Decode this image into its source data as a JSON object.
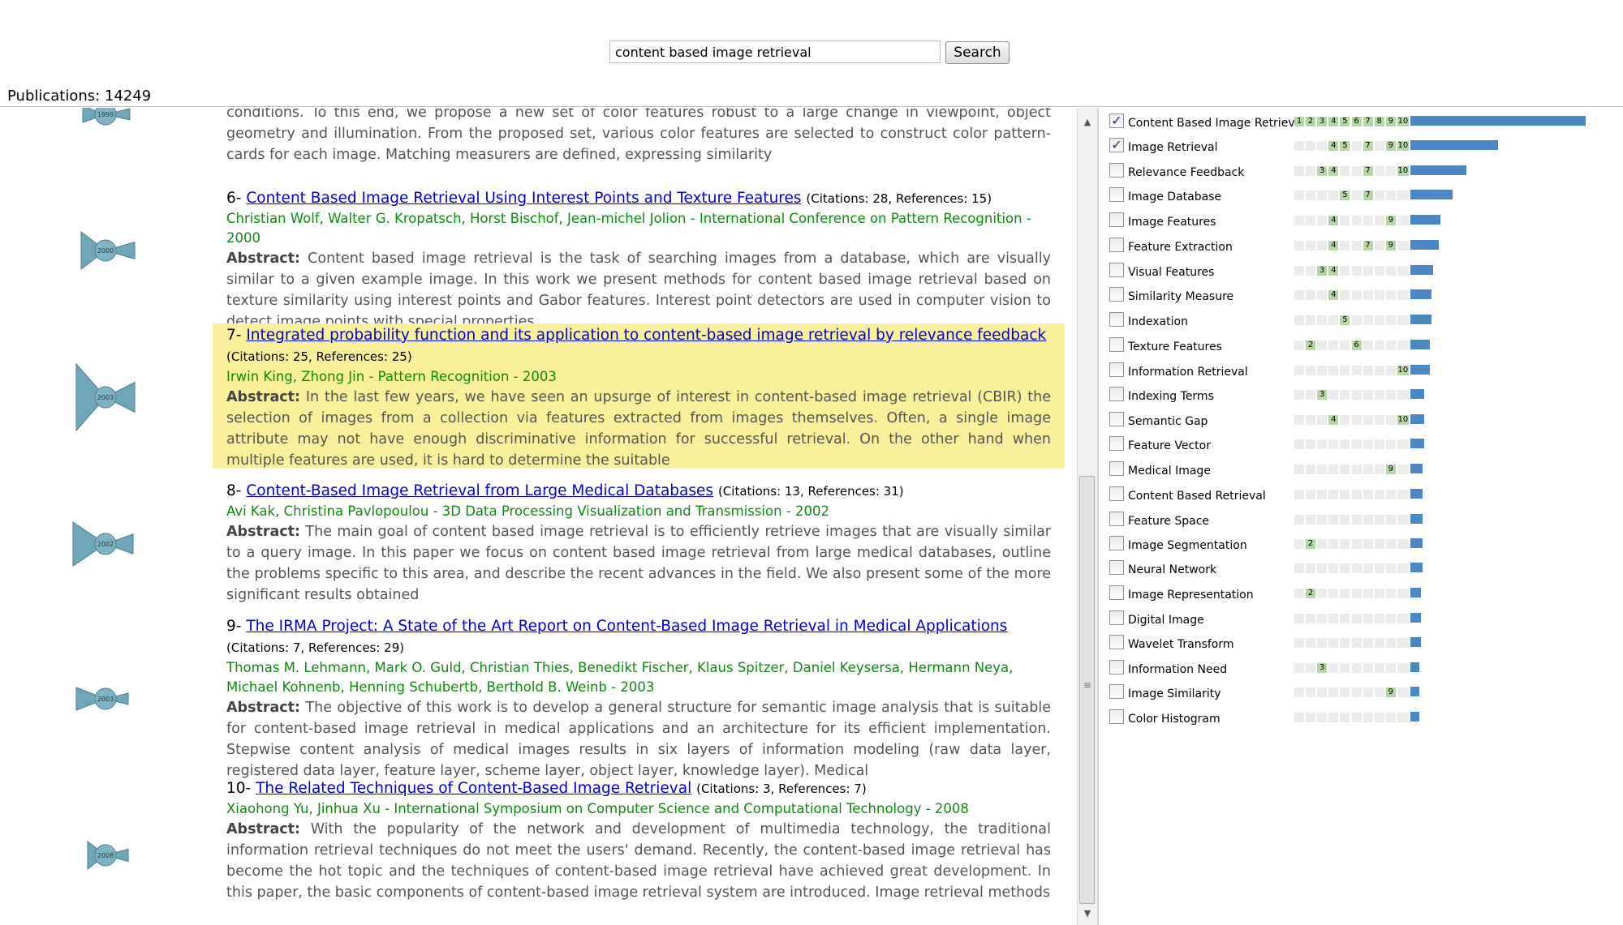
{
  "search": {
    "value": "content based image retrieval",
    "button_label": "Search"
  },
  "publications_count": "Publications: 14249",
  "colors": {
    "link": "#0000dd",
    "authors": "#118811",
    "highlight": "#f8f09a",
    "bar": "#4c86c3",
    "glyph": "#6fa6b8"
  },
  "abstract_label": "Abstract:",
  "glyph_years": [
    "1999",
    "2000",
    "2003",
    "2002",
    "2003",
    "2008"
  ],
  "publications": [
    {
      "number": "",
      "title": "",
      "citations": "",
      "authors": "",
      "abstract": "conditions. To this end, we propose a new set of color features robust to a large change in viewpoint, object geometry and illumination. From the proposed set, various color features are selected to construct color pattern-cards for each image. Matching measurers are defined, expressing similarity"
    },
    {
      "number": "6-",
      "title": "Content Based Image Retrieval Using Interest Points and Texture Features",
      "citations": "(Citations: 28, References: 15)",
      "authors": "Christian Wolf, Walter G. Kropatsch, Horst Bischof, Jean-michel Jolion - International Conference on Pattern Recognition - 2000",
      "abstract": "Content based image retrieval is the task of searching images from a database, which are visually similar to a given example image. In this work we present methods for content based image retrieval based on texture similarity using interest points and Gabor features. Interest point detectors are used in computer vision to detect image points with special properties,"
    },
    {
      "number": "7-",
      "title": "Integrated probability function and its application to content-based image retrieval by relevance feedback",
      "citations": "(Citations: 25, References: 25)",
      "authors": "Irwin King, Zhong Jin - Pattern Recognition - 2003",
      "abstract": "In the last few years, we have seen an upsurge of interest in content-based image retrieval (CBIR) the selection of images from a collection via features extracted from images themselves. Often, a single image attribute may not have enough discriminative information for successful retrieval. On the other hand when multiple features are used, it is hard to determine the suitable"
    },
    {
      "number": "8-",
      "title": "Content-Based Image Retrieval from Large Medical Databases",
      "citations": "(Citations: 13, References: 31)",
      "authors": "Avi Kak, Christina Pavlopoulou - 3D Data Processing Visualization and Transmission - 2002",
      "abstract": "The main goal of content based image retrieval is to efficiently retrieve images that are visually similar to a query image. In this paper we focus on content based image retrieval from large medical databases, outline the problems specific to this area, and describe the recent advances in the field. We also present some of the more significant results obtained"
    },
    {
      "number": "9-",
      "title": "The IRMA Project: A State of the Art Report on Content-Based Image Retrieval in Medical Applications",
      "citations": "(Citations: 7, References: 29)",
      "authors": "Thomas M. Lehmann, Mark O. Guld, Christian Thies, Benedikt Fischer, Klaus Spitzer, Daniel Keysersa, Hermann Neya, Michael Kohnenb, Henning Schubertb, Berthold B. Weinb - 2003",
      "abstract": "The objective of this work is to develop a general structure for semantic image analysis that is suitable for content-based image retrieval in medical applications and an architecture for its efficient implementation. Stepwise content analysis of medical images results in six layers of information modeling (raw data layer, registered data layer, feature layer, scheme layer, object layer, knowledge layer). Medical"
    },
    {
      "number": "10-",
      "title": "The Related Techniques of Content-Based Image Retrieval",
      "citations": "(Citations: 3, References: 7)",
      "authors": "Xiaohong Yu, Jinhua Xu - International Symposium on Computer Science and Computational Technology - 2008",
      "abstract": "With the popularity of the network and development of multimedia technology, the traditional information retrieval techniques do not meet the users' demand. Recently, the content-based image retrieval has become the hot topic and the techniques of content-based image retrieval have achieved great development. In this paper, the basic components of content-based image retrieval system are introduced. Image retrieval methods"
    }
  ],
  "keywords": [
    {
      "label": "Content Based Image Retrieval",
      "checked": true,
      "active": [
        1,
        2,
        3,
        4,
        5,
        6,
        7,
        8,
        9,
        10
      ],
      "weight": 1.0
    },
    {
      "label": "Image Retrieval",
      "checked": true,
      "active": [
        4,
        5,
        7,
        9,
        10
      ],
      "weight": 0.5
    },
    {
      "label": "Relevance Feedback",
      "checked": false,
      "active": [
        3,
        4,
        7,
        10
      ],
      "weight": 0.32
    },
    {
      "label": "Image Database",
      "checked": false,
      "active": [
        5,
        7
      ],
      "weight": 0.24
    },
    {
      "label": "Image Features",
      "checked": false,
      "active": [
        4,
        9
      ],
      "weight": 0.17
    },
    {
      "label": "Feature Extraction",
      "checked": false,
      "active": [
        4,
        7,
        9
      ],
      "weight": 0.16
    },
    {
      "label": "Visual Features",
      "checked": false,
      "active": [
        3,
        4
      ],
      "weight": 0.13
    },
    {
      "label": "Similarity Measure",
      "checked": false,
      "active": [
        4
      ],
      "weight": 0.12
    },
    {
      "label": "Indexation",
      "checked": false,
      "active": [
        5
      ],
      "weight": 0.12
    },
    {
      "label": "Texture Features",
      "checked": false,
      "active": [
        2,
        6
      ],
      "weight": 0.11
    },
    {
      "label": "Information Retrieval",
      "checked": false,
      "active": [
        10
      ],
      "weight": 0.11
    },
    {
      "label": "Indexing Terms",
      "checked": false,
      "active": [
        3
      ],
      "weight": 0.08
    },
    {
      "label": "Semantic Gap",
      "checked": false,
      "active": [
        4,
        10
      ],
      "weight": 0.08
    },
    {
      "label": "Feature Vector",
      "checked": false,
      "active": [],
      "weight": 0.08
    },
    {
      "label": "Medical Image",
      "checked": false,
      "active": [
        9
      ],
      "weight": 0.07
    },
    {
      "label": "Content Based Retrieval",
      "checked": false,
      "active": [],
      "weight": 0.07
    },
    {
      "label": "Feature Space",
      "checked": false,
      "active": [],
      "weight": 0.07
    },
    {
      "label": "Image Segmentation",
      "checked": false,
      "active": [
        2
      ],
      "weight": 0.07
    },
    {
      "label": "Neural Network",
      "checked": false,
      "active": [],
      "weight": 0.07
    },
    {
      "label": "Image Representation",
      "checked": false,
      "active": [
        2
      ],
      "weight": 0.06
    },
    {
      "label": "Digital Image",
      "checked": false,
      "active": [],
      "weight": 0.06
    },
    {
      "label": "Wavelet Transform",
      "checked": false,
      "active": [],
      "weight": 0.06
    },
    {
      "label": "Information Need",
      "checked": false,
      "active": [
        3
      ],
      "weight": 0.05
    },
    {
      "label": "Image Similarity",
      "checked": false,
      "active": [
        9
      ],
      "weight": 0.05
    },
    {
      "label": "Color Histogram",
      "checked": false,
      "active": [],
      "weight": 0.05
    }
  ]
}
